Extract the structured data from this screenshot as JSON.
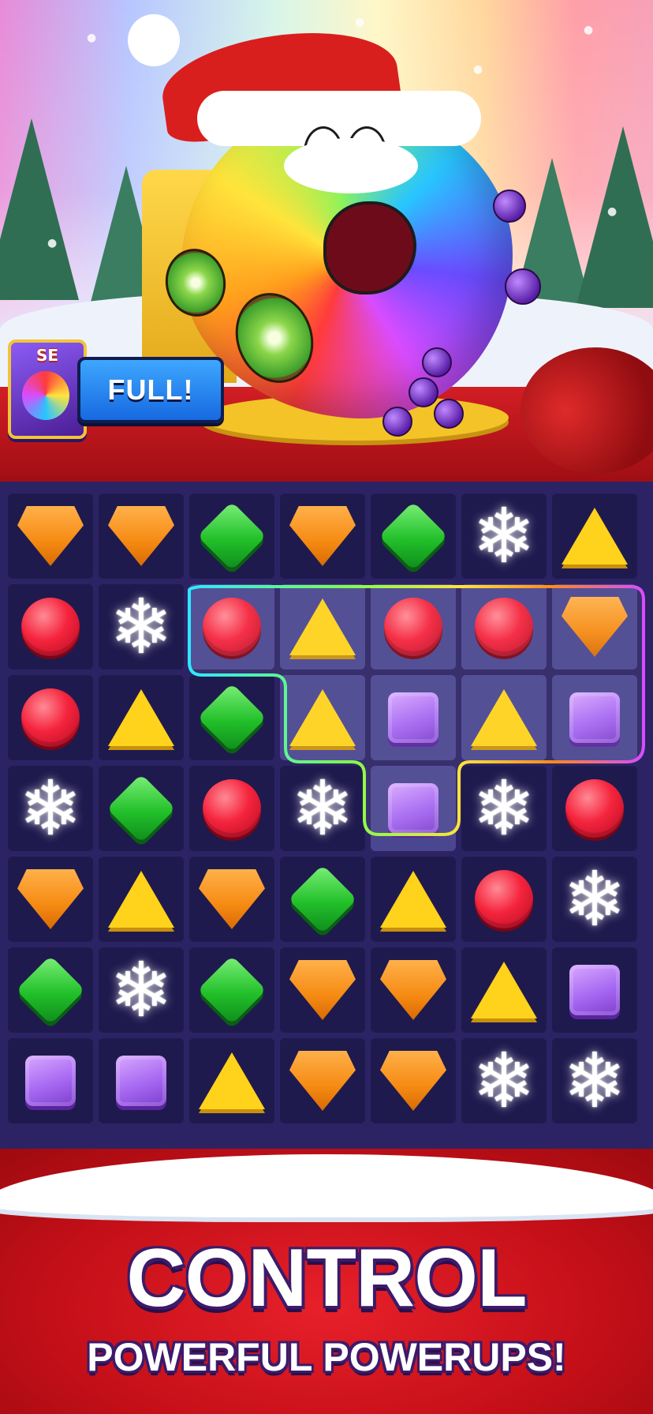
{
  "hero": {
    "card_label": "SE",
    "status_label": "FULL!"
  },
  "board": {
    "rows": [
      [
        "orange",
        "orange",
        "green",
        "orange",
        "green",
        "snowflake",
        "yellow"
      ],
      [
        "red",
        "snowflake",
        "red",
        "yellow",
        "red",
        "red",
        "orange"
      ],
      [
        "red",
        "yellow",
        "green",
        "yellow",
        "purple",
        "yellow",
        "purple"
      ],
      [
        "snowflake",
        "green",
        "red",
        "snowflake",
        "purple",
        "snowflake",
        "red"
      ],
      [
        "orange",
        "yellow",
        "orange",
        "green",
        "yellow",
        "red",
        "snowflake"
      ],
      [
        "green",
        "snowflake",
        "green",
        "orange",
        "orange",
        "yellow",
        "purple"
      ],
      [
        "purple",
        "purple",
        "yellow",
        "orange",
        "orange",
        "snowflake",
        "snowflake"
      ]
    ],
    "highlighted_cells": [
      [
        1,
        2
      ],
      [
        1,
        3
      ],
      [
        1,
        4
      ],
      [
        1,
        5
      ],
      [
        1,
        6
      ],
      [
        2,
        3
      ],
      [
        2,
        4
      ],
      [
        2,
        5
      ],
      [
        2,
        6
      ],
      [
        3,
        4
      ]
    ]
  },
  "banner": {
    "title": "CONTROL",
    "subtitle": "POWERFUL POWERUPS!"
  },
  "colors": {
    "board_bg": "#2c2364",
    "tile": "#1f1a4e",
    "banner_red": "#c40f18",
    "full_blue": "#1769e0"
  }
}
